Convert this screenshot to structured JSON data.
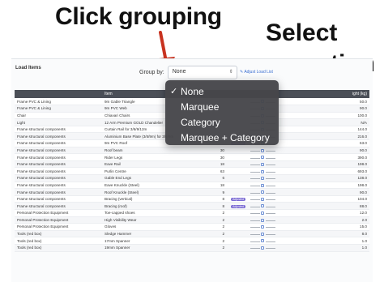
{
  "annotations": {
    "top": "Click grouping",
    "right_line1": "Select",
    "right_line2": "an option"
  },
  "panel": {
    "title": "Load Items",
    "groupby_label": "Group by:",
    "groupby_value": "None",
    "adjust_link": "Adjust Load List"
  },
  "table": {
    "headers": [
      "",
      "Item",
      "",
      "",
      "",
      "ight (kg)"
    ],
    "rows": [
      {
        "category": "Frame PVC & Lining",
        "item": "9m Gable Triangle",
        "qty": "",
        "badge": "",
        "weight": "50.0"
      },
      {
        "category": "Frame PVC & Lining",
        "item": "9m PVC Web",
        "qty": "",
        "badge": "",
        "weight": "90.0"
      },
      {
        "category": "Chair",
        "item": "Chiavari Chairs",
        "qty": "",
        "badge": "",
        "weight": "100.0"
      },
      {
        "category": "Light",
        "item": "12 Arm Premium GOLD Chandelier",
        "qty": "",
        "badge": "",
        "weight": "N/A"
      },
      {
        "category": "Frame structural components",
        "item": "Curtain Rail for 3/6/9/12m",
        "qty": "",
        "badge": "",
        "weight": "144.0"
      },
      {
        "category": "Frame structural components",
        "item": "Aluminium Base Plate (3/6/9m) for 3/6/9m",
        "qty": "",
        "badge": "",
        "weight": "216.0"
      },
      {
        "category": "Frame structural components",
        "item": "9m PVC Roof",
        "qty": "",
        "badge": "Adjusted",
        "weight": "63.0"
      },
      {
        "category": "Frame structural components",
        "item": "Roof beam",
        "qty": "30",
        "badge": "",
        "weight": "90.0"
      },
      {
        "category": "Frame structural components",
        "item": "Rider Legs",
        "qty": "30",
        "badge": "",
        "weight": "390.0"
      },
      {
        "category": "Frame structural components",
        "item": "Eave Rail",
        "qty": "18",
        "badge": "",
        "weight": "198.0"
      },
      {
        "category": "Frame structural components",
        "item": "Purlin Centre",
        "qty": "63",
        "badge": "",
        "weight": "693.0"
      },
      {
        "category": "Frame structural components",
        "item": "Gable End Legs",
        "qty": "6",
        "badge": "",
        "weight": "138.0"
      },
      {
        "category": "Frame structural components",
        "item": "Eave Knuckle (Steel)",
        "qty": "18",
        "badge": "",
        "weight": "198.0"
      },
      {
        "category": "Frame structural components",
        "item": "Roof Knuckle (Steel)",
        "qty": "9",
        "badge": "",
        "weight": "90.0"
      },
      {
        "category": "Frame structural components",
        "item": "Bracing (vertical)",
        "qty": "8",
        "badge": "Adjusted",
        "weight": "104.0"
      },
      {
        "category": "Frame structural components",
        "item": "Bracing (roof)",
        "qty": "8",
        "badge": "Adjusted",
        "weight": "88.0"
      },
      {
        "category": "Personal Protection Equipment",
        "item": "Toe-capped shoes",
        "qty": "2",
        "badge": "",
        "weight": "12.0"
      },
      {
        "category": "Personal Protection Equipment",
        "item": "High Visibility Wear",
        "qty": "2",
        "badge": "",
        "weight": "2.0"
      },
      {
        "category": "Personal Protection Equipment",
        "item": "Gloves",
        "qty": "2",
        "badge": "",
        "weight": "15.0"
      },
      {
        "category": "Tools (red box)",
        "item": "Sledge Hammer",
        "qty": "2",
        "badge": "",
        "weight": "8.0"
      },
      {
        "category": "Tools (red box)",
        "item": "17mm Spanner",
        "qty": "2",
        "badge": "",
        "weight": "1.0"
      },
      {
        "category": "Tools (red box)",
        "item": "19mm Spanner",
        "qty": "2",
        "badge": "",
        "weight": "1.0"
      }
    ]
  },
  "dropdown": {
    "options": [
      {
        "label": "None",
        "checked": true
      },
      {
        "label": "Marquee",
        "checked": false
      },
      {
        "label": "Category",
        "checked": false
      },
      {
        "label": "Marquee + Category",
        "checked": false
      }
    ],
    "check_glyph": "✓"
  },
  "colors": {
    "arrow": "#c8321f",
    "badge": "#7c6cd4",
    "header": "#4b4f57",
    "link": "#3a6fd0"
  }
}
